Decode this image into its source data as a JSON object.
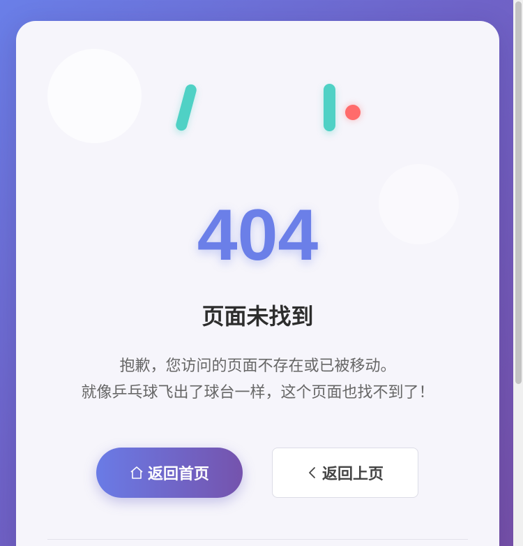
{
  "error": {
    "code": "404",
    "title": "页面未找到",
    "description_line1": "抱歉，您访问的页面不存在或已被移动。",
    "description_line2": "就像乒乓球飞出了球台一样，这个页面也找不到了！"
  },
  "buttons": {
    "home": {
      "label": "返回首页",
      "icon": "home-icon"
    },
    "back": {
      "label": "返回上页",
      "icon": "chevron-left-icon"
    }
  },
  "colors": {
    "accent": "#6b7fe8",
    "paddle": "#4fd1c5",
    "ball": "#ff6b6b",
    "gradient_start": "#6a7be6",
    "gradient_end": "#7553ad"
  }
}
